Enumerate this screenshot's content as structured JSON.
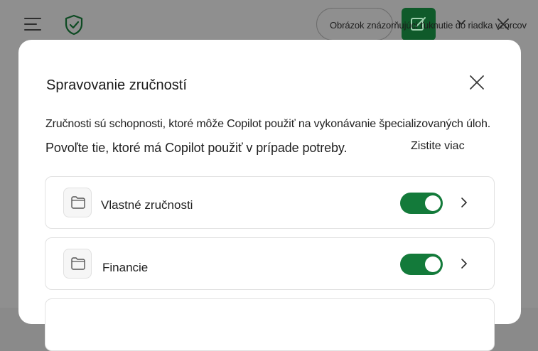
{
  "topbar": {
    "caption": "Obrázok znázorňujúci ťuknutie do riadka vzorcov"
  },
  "dialog": {
    "title": "Spravovanie zručností",
    "description_line1": "Zručnosti sú schopnosti, ktoré môže Copilot použiť na vykonávanie špecializovaných úloh.",
    "description_line2": "Povoľte tie, ktoré má Copilot použiť v prípade potreby.",
    "learn_more": "Zistite viac",
    "skills": [
      {
        "label": "Vlastné zručnosti",
        "enabled": true,
        "icon": "folder-icon"
      },
      {
        "label": "Financie",
        "enabled": true,
        "icon": "folder-icon"
      }
    ]
  },
  "colors": {
    "accent_green": "#137a3a",
    "dark_green": "#0f5a2a",
    "overlay": "#8f8f8f"
  }
}
